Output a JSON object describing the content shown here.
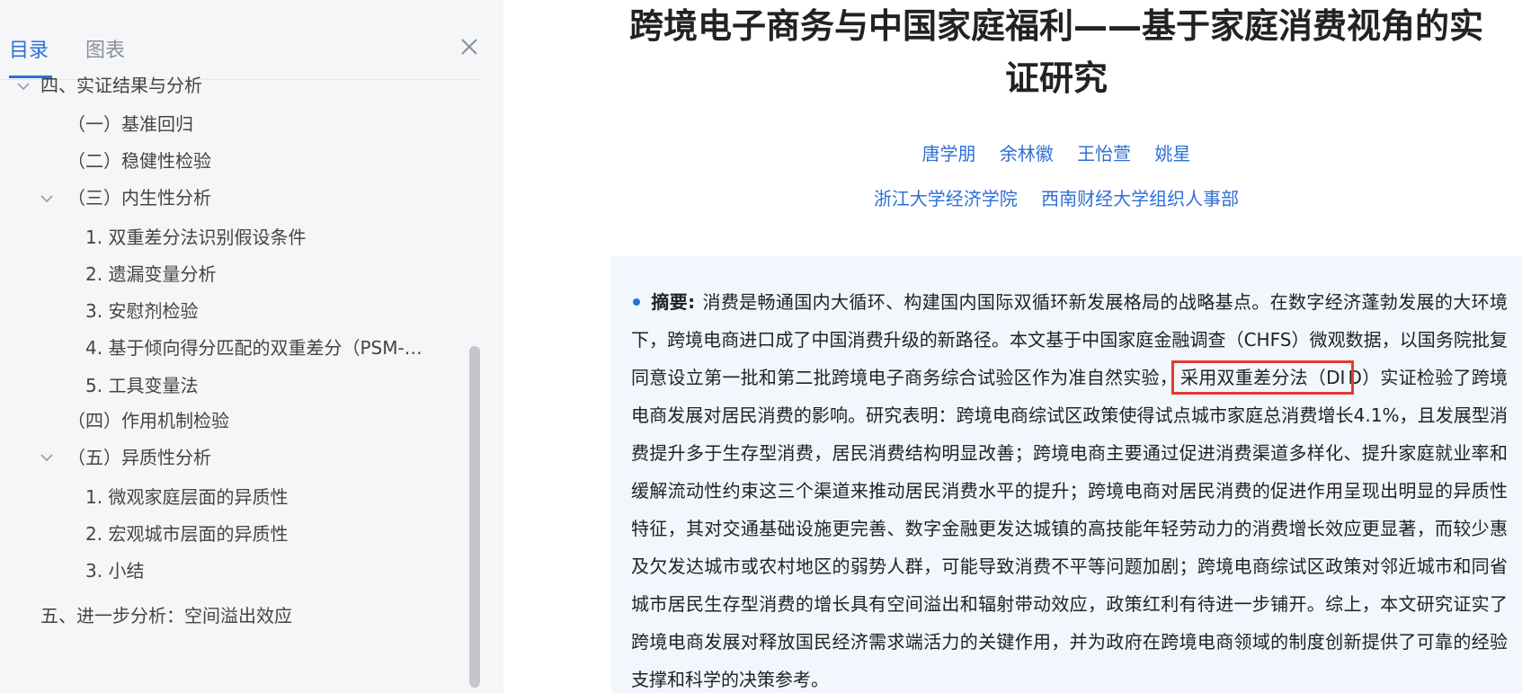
{
  "sidebar": {
    "tabs": [
      {
        "label": "目录",
        "active": true
      },
      {
        "label": "图表",
        "active": false
      }
    ],
    "toc": [
      {
        "label": "四、实证结果与分析",
        "level": 0,
        "expanded": true
      },
      {
        "label": "（一）基准回归",
        "level": 1
      },
      {
        "label": "（二）稳健性检验",
        "level": 1
      },
      {
        "label": "（三）内生性分析",
        "level": 1,
        "expanded": true
      },
      {
        "label": "1. 双重差分法识别假设条件",
        "level": 2
      },
      {
        "label": "2. 遗漏变量分析",
        "level": 2
      },
      {
        "label": "3. 安慰剂检验",
        "level": 2
      },
      {
        "label": "4. 基于倾向得分匹配的双重差分（PSM-…",
        "level": 2
      },
      {
        "label": "5. 工具变量法",
        "level": 2
      },
      {
        "label": "（四）作用机制检验",
        "level": 1
      },
      {
        "label": "（五）异质性分析",
        "level": 1,
        "expanded": true
      },
      {
        "label": "1. 微观家庭层面的异质性",
        "level": 2
      },
      {
        "label": "2. 宏观城市层面的异质性",
        "level": 2
      },
      {
        "label": "3. 小结",
        "level": 2
      },
      {
        "label": "五、进一步分析：空间溢出效应",
        "level": 0
      }
    ]
  },
  "paper": {
    "title_line1": "跨境电子商务与中国家庭福利——基于家庭消费视角的实",
    "title_line2": "证研究",
    "authors": [
      "唐学朋",
      "余林徽",
      "王怡萱",
      "姚星"
    ],
    "affiliations": [
      "浙江大学经济学院",
      "西南财经大学组织人事部"
    ],
    "abstract": {
      "label": "摘要:",
      "text_before": "消费是畅通国内大循环、构建国内国际双循环新发展格局的战略基点。在数字经济蓬勃发展的大环境下，跨境电商进口成了中国消费升级的新路径。本文基于中国家庭金融调查（CHFS）微观数据，以国务院批复同意设立第一批和第二批跨境电子商务综合试验区作为准自然实验，",
      "highlight": "采用双重差分法（DI",
      "text_after": "D）实证检验了跨境电商发展对居民消费的影响。研究表明：跨境电商综试区政策使得试点城市家庭总消费增长4.1%，且发展型消费提升多于生存型消费，居民消费结构明显改善；跨境电商主要通过促进消费渠道多样化、提升家庭就业率和缓解流动性约束这三个渠道来推动居民消费水平的提升；跨境电商对居民消费的促进作用呈现出明显的异质性特征，其对交通基础设施更完善、数字金融更发达城镇的高技能年轻劳动力的消费增长效应更显著，而较少惠及欠发达城市或农村地区的弱势人群，可能导致消费不平等问题加剧；跨境电商综试区政策对邻近城市和同省城市居民生存型消费的增长具有空间溢出和辐射带动效应，政策红利有待进一步铺开。综上，本文研究证实了跨境电商发展对释放国民经济需求端活力的关键作用，并为政府在跨境电商领域的制度创新提供了可靠的经验支撑和科学的决策参考。"
    }
  },
  "colors": {
    "accent": "#2f6fd6",
    "highlight_border": "#e33a32",
    "abstract_bg": "#f2f6fd",
    "sidebar_bg": "#f5f6f8"
  }
}
